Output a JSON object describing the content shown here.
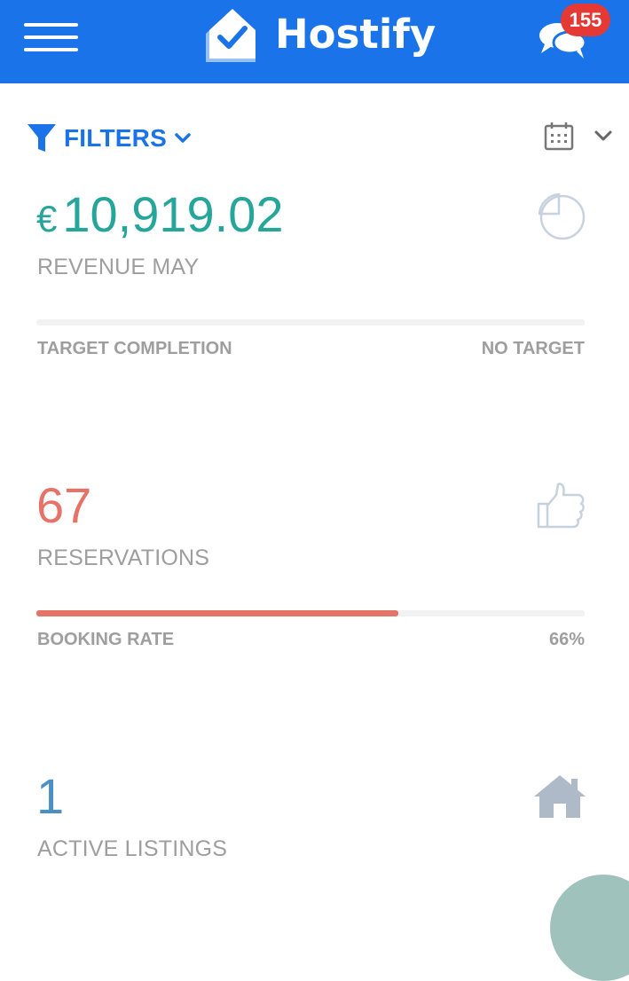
{
  "app": {
    "brand": "Hostify",
    "notifications_count": "155"
  },
  "icons": {
    "menu": "hamburger-menu-icon",
    "logo": "house-check-icon",
    "chat": "chat-bubbles-icon",
    "filter": "funnel-icon",
    "filter_chevron": "chevron-down-icon",
    "calendar": "calendar-icon",
    "calendar_chevron": "chevron-down-icon",
    "revenue": "pie-chart-icon",
    "reservations": "thumbs-up-icon",
    "listings": "home-icon"
  },
  "filters": {
    "label": "FILTERS"
  },
  "revenue": {
    "currency": "€",
    "amount": "10,919.02",
    "label": "REVENUE MAY",
    "progress_label": "TARGET COMPLETION",
    "progress_value": "NO TARGET",
    "progress_fraction": 0
  },
  "reservations": {
    "value": "67",
    "label": "RESERVATIONS",
    "progress_label": "BOOKING RATE",
    "progress_value": "66%",
    "progress_fraction": 0.66
  },
  "listings": {
    "value": "1",
    "label": "ACTIVE LISTINGS"
  },
  "colors": {
    "header_bg": "#1a73e8",
    "revenue_accent": "#26a69a",
    "reservations_accent": "#e57368",
    "listings_accent": "#4a90c2",
    "label_gray": "#9e9e9e",
    "badge_red": "#e53935"
  }
}
